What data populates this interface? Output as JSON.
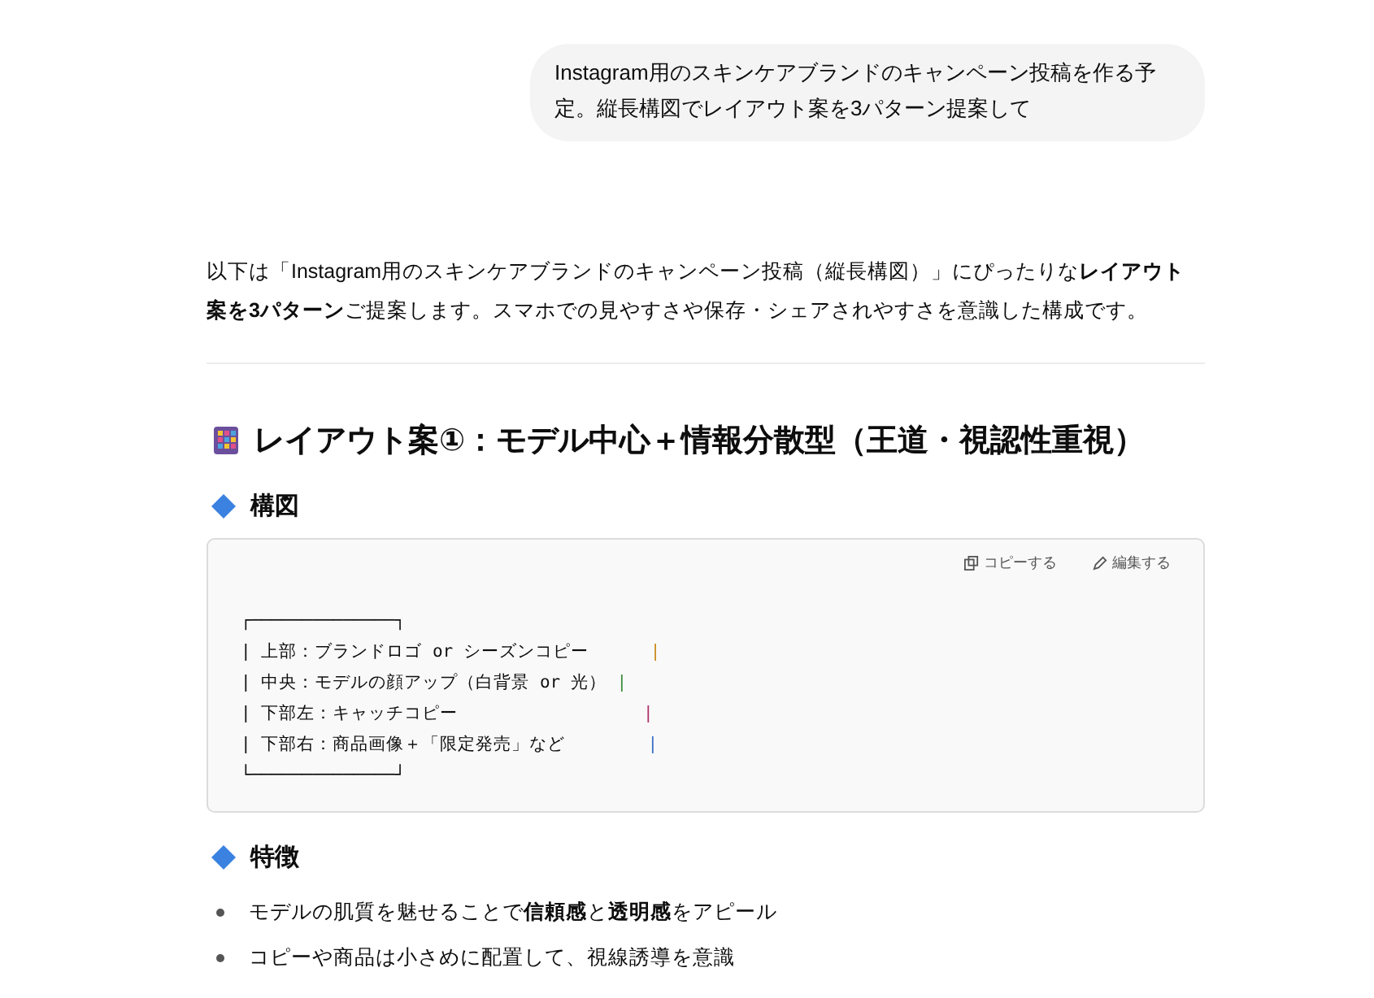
{
  "user_message": "Instagram用のスキンケアブランドのキャンペーン投稿を作る予定。縦長構図でレイアウト案を3パターン提案して",
  "intro": "以下は「Instagram用のスキンケアブランドのキャンペーン投稿（縦長構図）」にぴったりな**レイアウト案を3パターン**ご提案します。スマホでの見やすさや保存・シェアされやすさを意識した構成です。",
  "heading": "レイアウト案①：モデル中心＋情報分散型（王道・視認性重視）",
  "sections": [
    {
      "title": "構図",
      "kind": "code",
      "copy_label": "コピーする",
      "edit_label": "編集する",
      "lines": [
        {
          "text": "┌──────────────┐"
        },
        {
          "text": "| 上部：ブランドロゴ or シーズンコピー      ",
          "end": "|",
          "color": "#c98a1e"
        },
        {
          "text": "| 中央：モデルの顔アップ（白背景 or 光） ",
          "end": "|",
          "color": "#3c8a3c"
        },
        {
          "text": "| 下部左：キャッチコピー                  ",
          "end": "|",
          "color": "#b0306a"
        },
        {
          "text": "| 下部右：商品画像＋「限定発売」など        ",
          "end": "|",
          "color": "#3a6fc4"
        },
        {
          "text": "└──────────────┘"
        }
      ]
    },
    {
      "title": "特徴",
      "kind": "bullets",
      "items": [
        "モデルの肌質を魅せることで**信頼感**と**透明感**をアピール",
        "コピーや商品は小さめに配置して、視線誘導を意識"
      ]
    }
  ]
}
